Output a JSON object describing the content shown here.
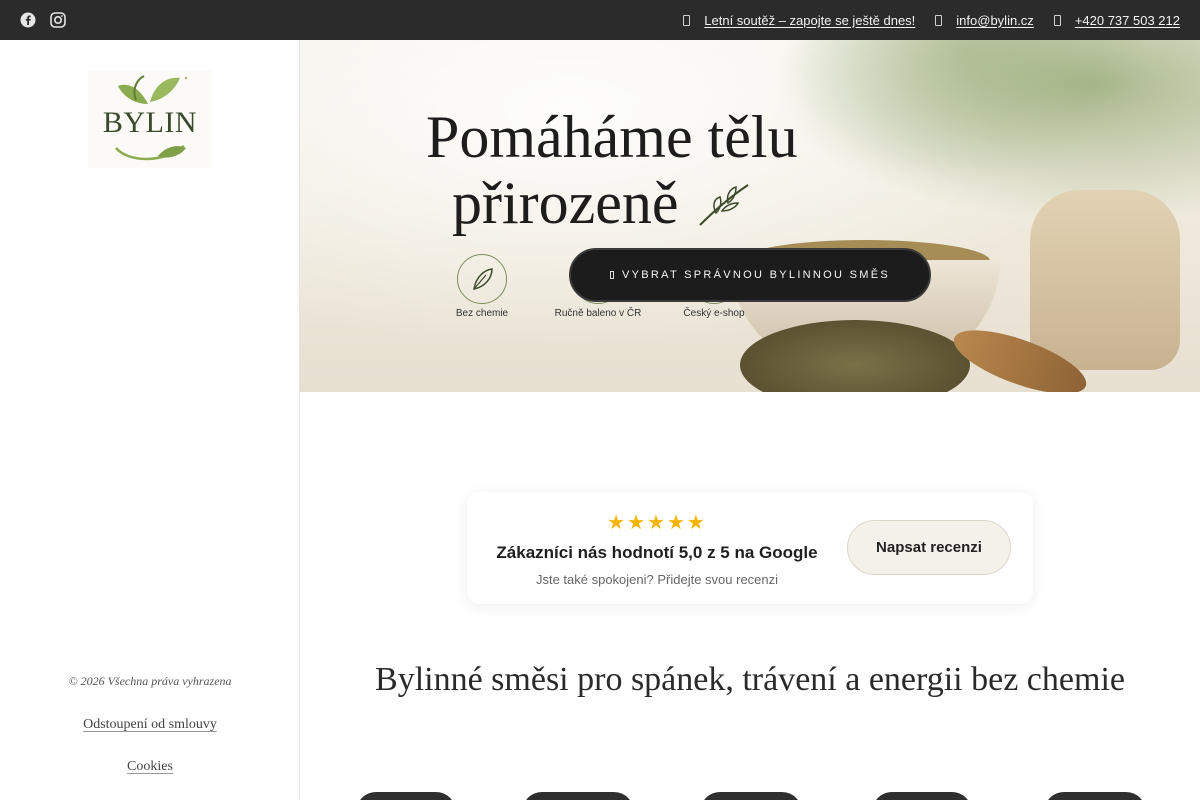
{
  "topbar": {
    "social": [
      "facebook-icon",
      "instagram-icon"
    ],
    "contacts": [
      {
        "icon": "gift-icon",
        "text": "Letní soutěž – zapojte se ještě dnes!"
      },
      {
        "icon": "mail-icon",
        "text": "info@bylin.cz"
      },
      {
        "icon": "phone-icon",
        "text": "+420 737 503 212"
      }
    ]
  },
  "sidebar": {
    "logo_text": "BYLIN",
    "copyright": "© 2026 Všechna práva vyhrazena",
    "links": [
      "Odstoupení od smlouvy",
      "Cookies"
    ]
  },
  "hero": {
    "title_line1": "Pomáháme tělu",
    "title_line2": "přirozeně",
    "badges": [
      "Bez chemie",
      "Ručně baleno v ČR",
      "Český e-shop"
    ],
    "cta_label": "VYBRAT SPRÁVNOU BYLINNOU SMĚS"
  },
  "review": {
    "stars": "★★★★★",
    "rating": 5,
    "title": "Zákazníci nás hodnotí 5,0 z 5 na Google",
    "subtitle": "Jste také spokojeni? Přidejte svou recenzi ",
    "button_label": "Napsat recenzi"
  },
  "section": {
    "heading": "Bylinné směsi pro spánek, trávení a energii bez chemie"
  },
  "colors": {
    "topbar_bg": "#2b2b2b",
    "cta_bg": "#1c1c1c",
    "star": "#f5b400",
    "accent_green": "#7a8f5b"
  }
}
